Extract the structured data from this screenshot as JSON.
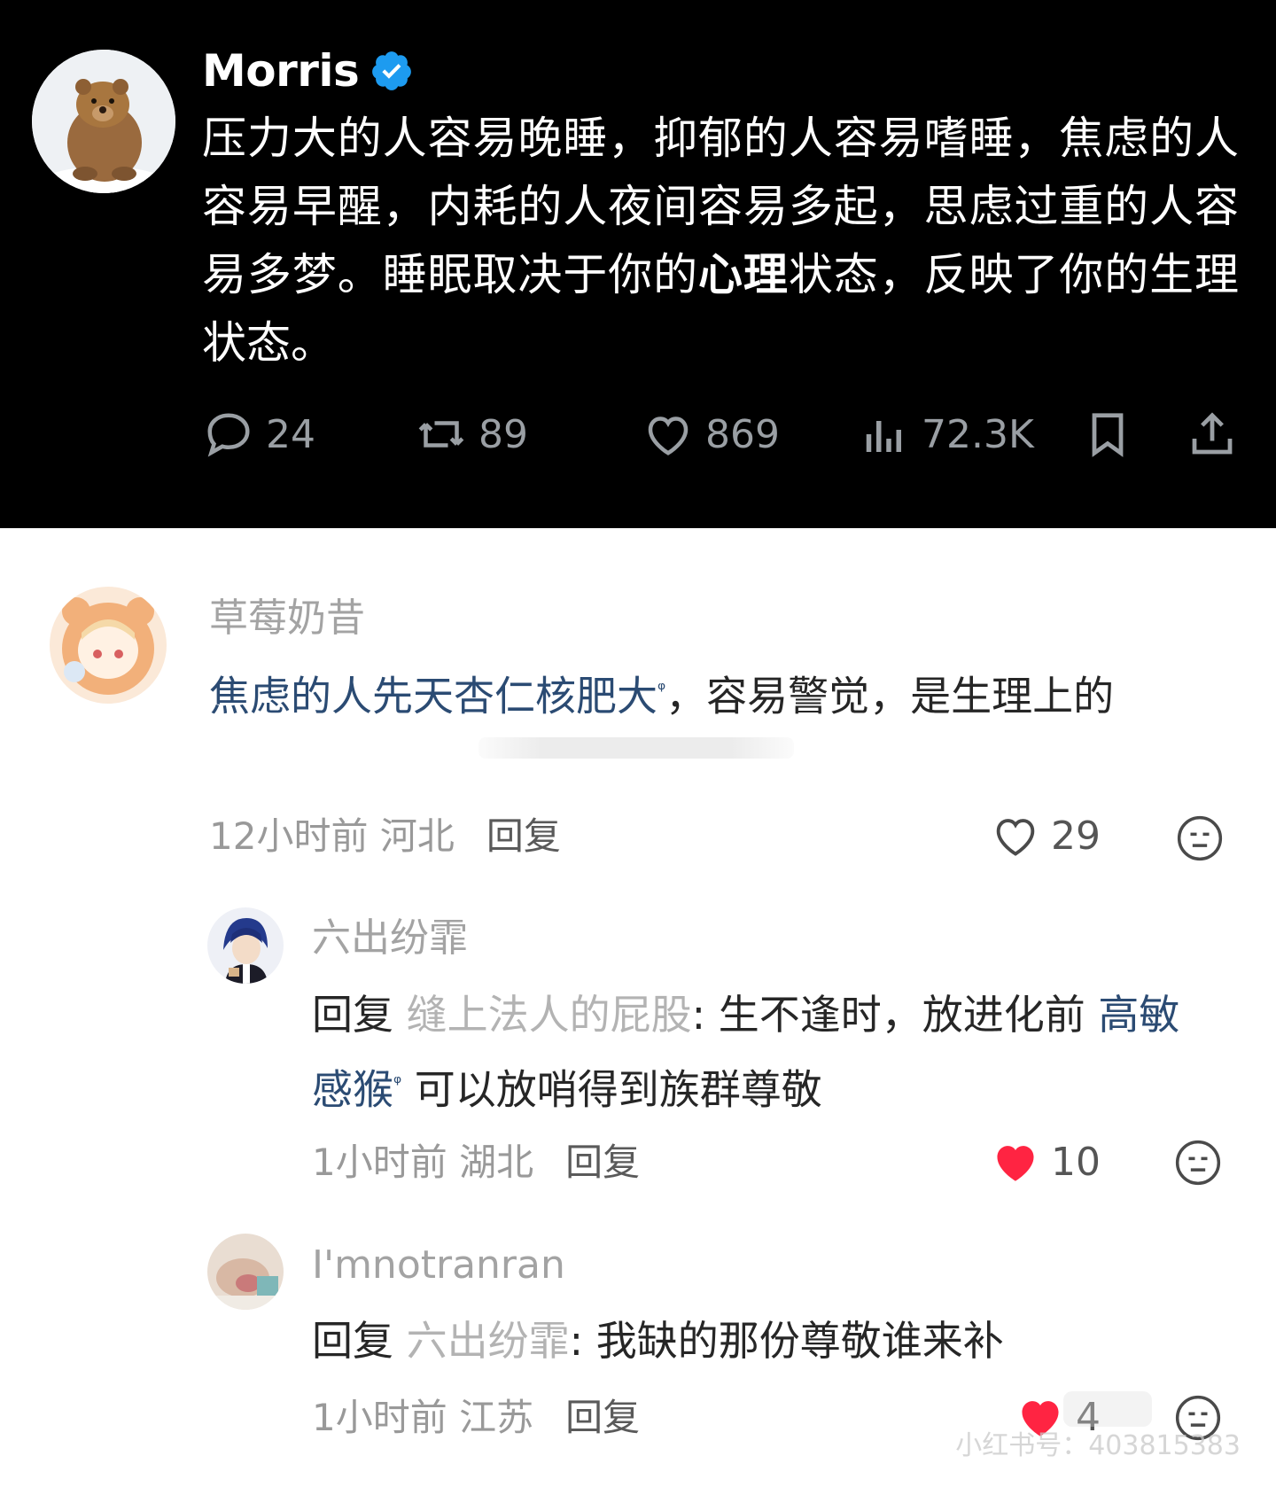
{
  "tweet": {
    "author": "Morris",
    "text_before": "压力大的人容易晚睡，抑郁的人容易嗜睡，焦虑的人容易早醒，内耗的人夜间容易多起，思虑过重的人容易多梦。睡眠取决于你的",
    "text_bold": "心理",
    "text_after": "状态，反映了你的生理状态。",
    "stats": {
      "replies": "24",
      "retweets": "89",
      "likes": "869",
      "views": "72.3K"
    },
    "icons": [
      "reply-icon",
      "retweet-icon",
      "heart-icon",
      "views-icon",
      "bookmark-icon",
      "share-icon"
    ],
    "accent_color": "#1d9bf0"
  },
  "comments": [
    {
      "username": "草莓奶昔",
      "text_link": "焦虑的人先天杏仁核肥大",
      "text_rest": "，容易警觉，是生理上的",
      "time": "12小时前",
      "location": "河北",
      "reply_label": "回复",
      "likes": "29",
      "liked": false
    },
    {
      "username": "六出纷霏",
      "reply_prefix": "回复",
      "reply_to": "缝上法人的屁股",
      "text_a": ": 生不逢时，放进化前 ",
      "text_link": "高敏感猴",
      "text_b": " 可以放哨得到族群尊敬",
      "time": "1小时前",
      "location": "湖北",
      "reply_label": "回复",
      "likes": "10",
      "liked": true
    },
    {
      "username": "I'mnotranran",
      "reply_prefix": "回复",
      "reply_to": "六出纷霏",
      "text_a": ": 我缺的那份尊敬谁来补",
      "time": "1小时前",
      "location": "江苏",
      "reply_label": "回复",
      "likes": "4",
      "liked": true
    }
  ],
  "watermark": "小红书号：403815383",
  "colors": {
    "like_red": "#ff2442",
    "link_blue": "#2b4b73"
  }
}
